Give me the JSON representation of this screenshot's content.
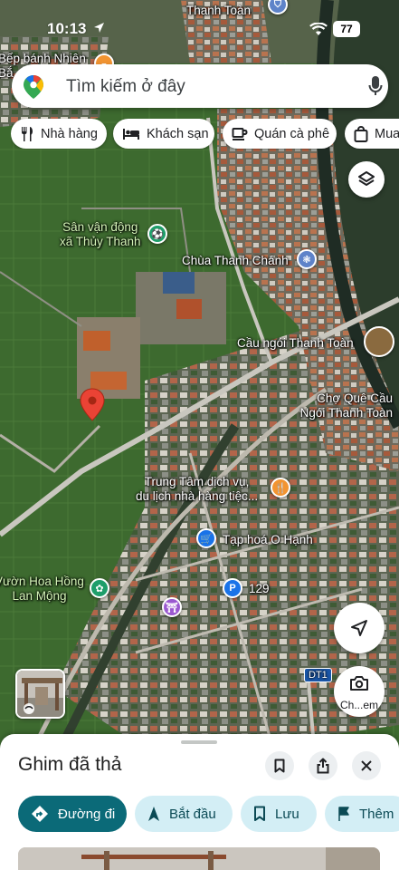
{
  "status_bar": {
    "time": "10:13",
    "battery": "77"
  },
  "search": {
    "placeholder": "Tìm kiếm ở đây"
  },
  "chips": [
    {
      "label": "Nhà hàng",
      "icon": "fork-knife-icon"
    },
    {
      "label": "Khách sạn",
      "icon": "bed-icon"
    },
    {
      "label": "Quán cà phê",
      "icon": "coffee-icon"
    },
    {
      "label": "Mua",
      "icon": "shopping-bag-icon"
    }
  ],
  "map": {
    "labels": {
      "top_place": "Thanh Toàn",
      "top_left_place": "Bếp bánh Nhiên\nBắ",
      "stadium": "Sân vận động\nxã Thủy Thanh",
      "pagoda": "Chùa Thanh Chánh",
      "bridge": "Cầu ngói Thanh Toàn",
      "market": "Chợ Quê Cầu\nNgói Thanh Toàn",
      "service_center": "Trung Tâm dịch vụ,\ndu lịch nhà hàng tiệc...",
      "grocery": "Tạp hoá O Hạnh",
      "rose_garden": "Vườn Hoa Hồng\nLan Mộng",
      "parking_number": "129",
      "road": "DT1"
    }
  },
  "street_view_label": "Ch...em",
  "sheet": {
    "title": "Ghim đã thả",
    "actions": {
      "directions": "Đường đi",
      "start": "Bắt đầu",
      "save": "Lưu",
      "more": "Thêm"
    }
  },
  "colors": {
    "accent": "#0b6a78",
    "secondary_chip": "#d3eef5",
    "pin": "#ea4335"
  }
}
